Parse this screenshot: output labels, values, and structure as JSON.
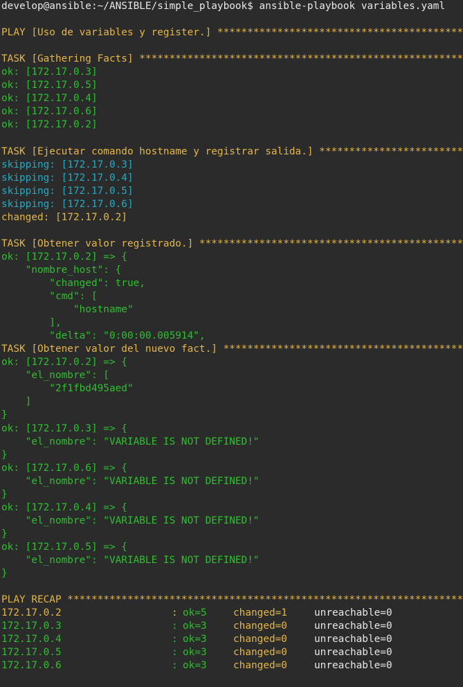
{
  "colors": {
    "background": "#2b2b2b",
    "white": "#e8e8e8",
    "yellow": "#e5b64a",
    "green": "#2fbf30",
    "cyan": "#29a9c1"
  },
  "lines": [
    {
      "text": "develop@ansible:~/ANSIBLE/simple_playbook$ ansible-playbook variables.yaml",
      "color": "white"
    },
    {
      "text": "",
      "color": "white"
    },
    {
      "text": "PLAY [Uso de variables y register.] ************************************************",
      "color": "yellow"
    },
    {
      "text": "",
      "color": "white"
    },
    {
      "text": "TASK [Gathering Facts] *************************************************************",
      "color": "yellow"
    },
    {
      "text": "ok: [172.17.0.3]",
      "color": "green"
    },
    {
      "text": "ok: [172.17.0.5]",
      "color": "green"
    },
    {
      "text": "ok: [172.17.0.4]",
      "color": "green"
    },
    {
      "text": "ok: [172.17.0.6]",
      "color": "green"
    },
    {
      "text": "ok: [172.17.0.2]",
      "color": "green"
    },
    {
      "text": "",
      "color": "white"
    },
    {
      "text": "TASK [Ejecutar comando hostname y registrar salida.] ***************************",
      "color": "yellow"
    },
    {
      "text": "skipping: [172.17.0.3]",
      "color": "cyan"
    },
    {
      "text": "skipping: [172.17.0.4]",
      "color": "cyan"
    },
    {
      "text": "skipping: [172.17.0.5]",
      "color": "cyan"
    },
    {
      "text": "skipping: [172.17.0.6]",
      "color": "cyan"
    },
    {
      "text": "changed: [172.17.0.2]",
      "color": "yellow"
    },
    {
      "text": "",
      "color": "white"
    },
    {
      "text": "TASK [Obtener valor registrado.] ***********************************************",
      "color": "yellow"
    },
    {
      "text": "ok: [172.17.0.2] => {",
      "color": "green"
    },
    {
      "text": "    \"nombre_host\": {",
      "color": "green"
    },
    {
      "text": "        \"changed\": true,",
      "color": "green"
    },
    {
      "text": "        \"cmd\": [",
      "color": "green"
    },
    {
      "text": "            \"hostname\"",
      "color": "green"
    },
    {
      "text": "        ],",
      "color": "green"
    },
    {
      "text": "        \"delta\": \"0:00:00.005914\",",
      "color": "green"
    },
    {
      "text": "TASK [Obtener valor del nuevo fact.] *******************************************",
      "color": "yellow"
    },
    {
      "text": "ok: [172.17.0.2] => {",
      "color": "green"
    },
    {
      "text": "    \"el_nombre\": [",
      "color": "green"
    },
    {
      "text": "        \"2f1fbd495aed\"",
      "color": "green"
    },
    {
      "text": "    ]",
      "color": "green"
    },
    {
      "text": "}",
      "color": "green"
    },
    {
      "text": "ok: [172.17.0.3] => {",
      "color": "green"
    },
    {
      "text": "    \"el_nombre\": \"VARIABLE IS NOT DEFINED!\"",
      "color": "green"
    },
    {
      "text": "}",
      "color": "green"
    },
    {
      "text": "ok: [172.17.0.6] => {",
      "color": "green"
    },
    {
      "text": "    \"el_nombre\": \"VARIABLE IS NOT DEFINED!\"",
      "color": "green"
    },
    {
      "text": "}",
      "color": "green"
    },
    {
      "text": "ok: [172.17.0.4] => {",
      "color": "green"
    },
    {
      "text": "    \"el_nombre\": \"VARIABLE IS NOT DEFINED!\"",
      "color": "green"
    },
    {
      "text": "}",
      "color": "green"
    },
    {
      "text": "ok: [172.17.0.5] => {",
      "color": "green"
    },
    {
      "text": "    \"el_nombre\": \"VARIABLE IS NOT DEFINED!\"",
      "color": "green"
    },
    {
      "text": "}",
      "color": "green"
    },
    {
      "text": "",
      "color": "white"
    },
    {
      "text": "PLAY RECAP *************************************************************************",
      "color": "yellow"
    }
  ],
  "recap": [
    {
      "host": "172.17.0.2",
      "host_color": "yellow",
      "colon": ":",
      "ok": "ok=5",
      "changed": "changed=1",
      "changed_color": "yellow",
      "unreachable": "unreachable=0"
    },
    {
      "host": "172.17.0.3",
      "host_color": "green",
      "colon": ":",
      "ok": "ok=3",
      "changed": "changed=0",
      "changed_color": "yellow",
      "unreachable": "unreachable=0"
    },
    {
      "host": "172.17.0.4",
      "host_color": "green",
      "colon": ":",
      "ok": "ok=3",
      "changed": "changed=0",
      "changed_color": "yellow",
      "unreachable": "unreachable=0"
    },
    {
      "host": "172.17.0.5",
      "host_color": "green",
      "colon": ":",
      "ok": "ok=3",
      "changed": "changed=0",
      "changed_color": "yellow",
      "unreachable": "unreachable=0"
    },
    {
      "host": "172.17.0.6",
      "host_color": "green",
      "colon": ":",
      "ok": "ok=3",
      "changed": "changed=0",
      "changed_color": "yellow",
      "unreachable": "unreachable=0"
    }
  ]
}
